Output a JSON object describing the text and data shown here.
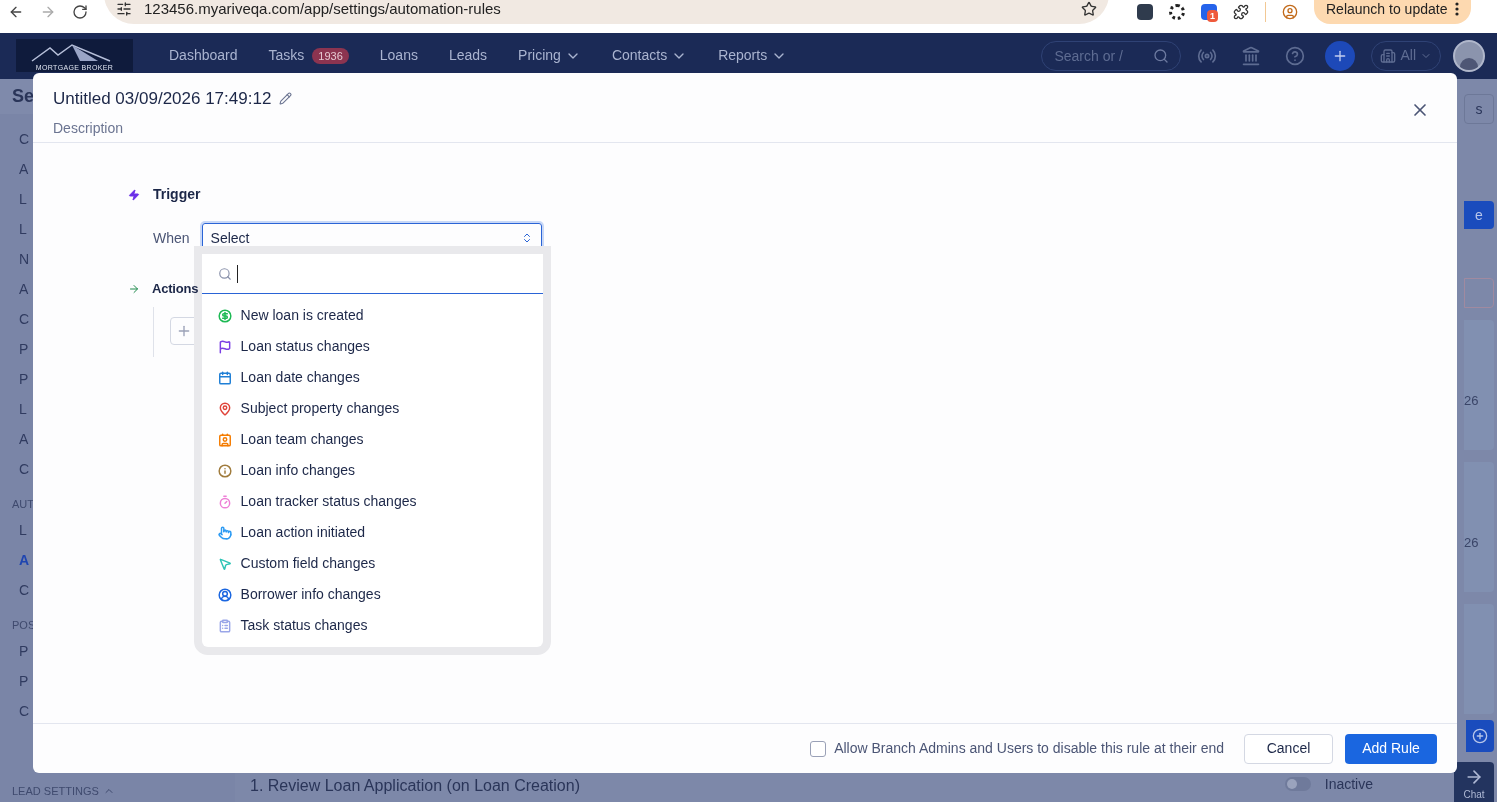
{
  "browser": {
    "url": "123456.myariveqa.com/app/settings/automation-rules",
    "extension_badge": "1",
    "relaunch_button": "Relaunch to update"
  },
  "nav": {
    "logo": "MORTGAGE BROKER",
    "items": [
      {
        "label": "Dashboard",
        "dropdown": false
      },
      {
        "label": "Tasks",
        "badge": "1936",
        "dropdown": false
      },
      {
        "label": "Loans",
        "dropdown": false
      },
      {
        "label": "Leads",
        "dropdown": false
      },
      {
        "label": "Pricing",
        "dropdown": true
      },
      {
        "label": "Contacts",
        "dropdown": true
      },
      {
        "label": "Reports",
        "dropdown": true
      }
    ],
    "search_placeholder": "Search or /",
    "org_filter": "All"
  },
  "background": {
    "sidebar_title": "Se",
    "sections": [
      {
        "items": [
          {
            "label": "C",
            "selected": false
          },
          {
            "label": "A",
            "selected": false
          },
          {
            "label": "L",
            "selected": false
          },
          {
            "label": "L",
            "selected": false
          },
          {
            "label": "N",
            "selected": false
          },
          {
            "label": "A",
            "selected": false
          },
          {
            "label": "C",
            "selected": false
          },
          {
            "label": "P",
            "selected": false
          },
          {
            "label": "P",
            "selected": false
          },
          {
            "label": "L",
            "selected": false
          },
          {
            "label": "A",
            "selected": false
          },
          {
            "label": "C",
            "selected": false
          }
        ]
      },
      {
        "heading": "AUT",
        "items": [
          {
            "label": "L",
            "selected": false
          },
          {
            "label": "A",
            "selected": true
          },
          {
            "label": "C",
            "selected": false
          }
        ]
      },
      {
        "heading": "POS",
        "items": [
          {
            "label": "P",
            "selected": false
          },
          {
            "label": "P",
            "selected": false
          },
          {
            "label": "C",
            "selected": false
          }
        ]
      }
    ],
    "sidebar_footer": "LEAD SETTINGS",
    "header_button": "s",
    "primary_button": "e",
    "card_dates": [
      "26",
      "26"
    ],
    "row_title": "1. Review Loan Application (on Loan Creation)",
    "row_status": "Inactive",
    "row_active": false,
    "chat_button": "Chat"
  },
  "modal": {
    "title": "Untitled 03/09/2026 17:49:12",
    "description": "Description",
    "trigger_heading": "Trigger",
    "when_label": "When",
    "select_placeholder": "Select",
    "options": [
      {
        "label": "New loan is created",
        "kind": "dollar",
        "color": "#1db954"
      },
      {
        "label": "Loan status changes",
        "kind": "flag",
        "color": "#7b3fe4"
      },
      {
        "label": "Loan date changes",
        "kind": "calendar",
        "color": "#1f7fd6"
      },
      {
        "label": "Subject property changes",
        "kind": "pin",
        "color": "#e0443a"
      },
      {
        "label": "Loan team changes",
        "kind": "contact",
        "color": "#f57c00"
      },
      {
        "label": "Loan info changes",
        "kind": "info",
        "color": "#a07b3c"
      },
      {
        "label": "Loan tracker status changes",
        "kind": "timer",
        "color": "#ee7fd6"
      },
      {
        "label": "Loan action initiated",
        "kind": "hand",
        "color": "#2b9af3"
      },
      {
        "label": "Custom field changes",
        "kind": "cursor",
        "color": "#2ec4b6"
      },
      {
        "label": "Borrower info changes",
        "kind": "user",
        "color": "#1a66e0"
      },
      {
        "label": "Task status changes",
        "kind": "clipboard",
        "color": "#9aa6e8"
      }
    ],
    "actions_heading": "Actions",
    "allow_disable": {
      "label": "Allow Branch Admins and Users to disable this rule at their end",
      "checked": false
    },
    "cancel_button": "Cancel",
    "add_button": "Add Rule"
  }
}
